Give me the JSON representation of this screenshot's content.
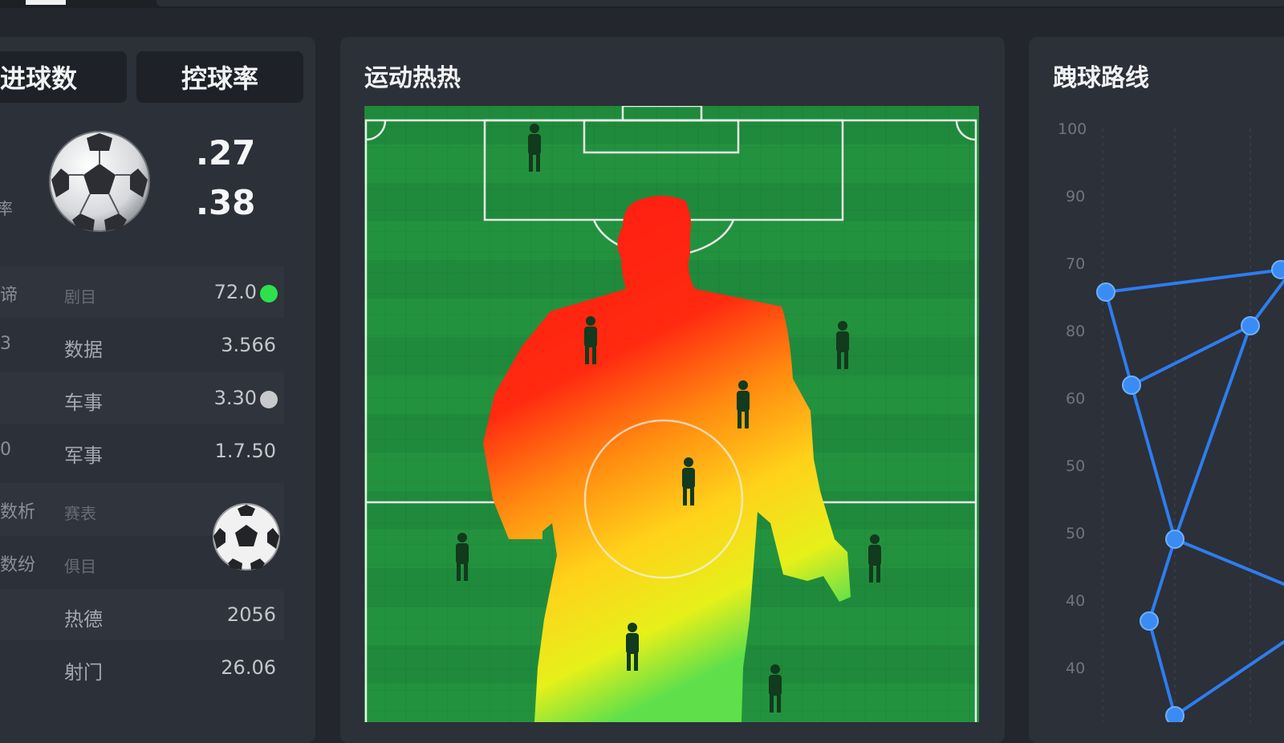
{
  "tabs": {
    "goals": "进球数",
    "possession": "控球率"
  },
  "summary": {
    "value_a": ".27",
    "value_b": ".38"
  },
  "stats": [
    {
      "cut": "谛",
      "label": "剧目",
      "value": "72.0",
      "dot": "#2fe04d"
    },
    {
      "cut": "3",
      "label": "数据",
      "value": "3.566",
      "dot": ""
    },
    {
      "cut": "",
      "label": "车事",
      "value": "3.30",
      "dot": "#c8c9cc"
    },
    {
      "cut": "0",
      "label": "军事",
      "value": "1.7.50",
      "dot": ""
    },
    {
      "cut": "数析",
      "label": "赛表",
      "value": "",
      "dot": ""
    },
    {
      "cut": "数纷",
      "label": "俱目",
      "value": "",
      "dot": ""
    },
    {
      "cut": "",
      "label": "热德",
      "value": "2056",
      "dot": ""
    },
    {
      "cut": "",
      "label": "射门",
      "value": "26.06",
      "dot": ""
    }
  ],
  "left_cut_label": "率",
  "heatmap": {
    "title": "运动热热"
  },
  "route": {
    "title": "跩球路线",
    "y_labels": [
      "100",
      "90",
      "70",
      "80",
      "60",
      "50",
      "50",
      "40",
      "40"
    ],
    "colors": {
      "line": "#2d7df0",
      "node": "#3b8bf5"
    }
  },
  "colors": {
    "pitch": "#1f8a3c",
    "accent_green": "#2fe04d"
  }
}
